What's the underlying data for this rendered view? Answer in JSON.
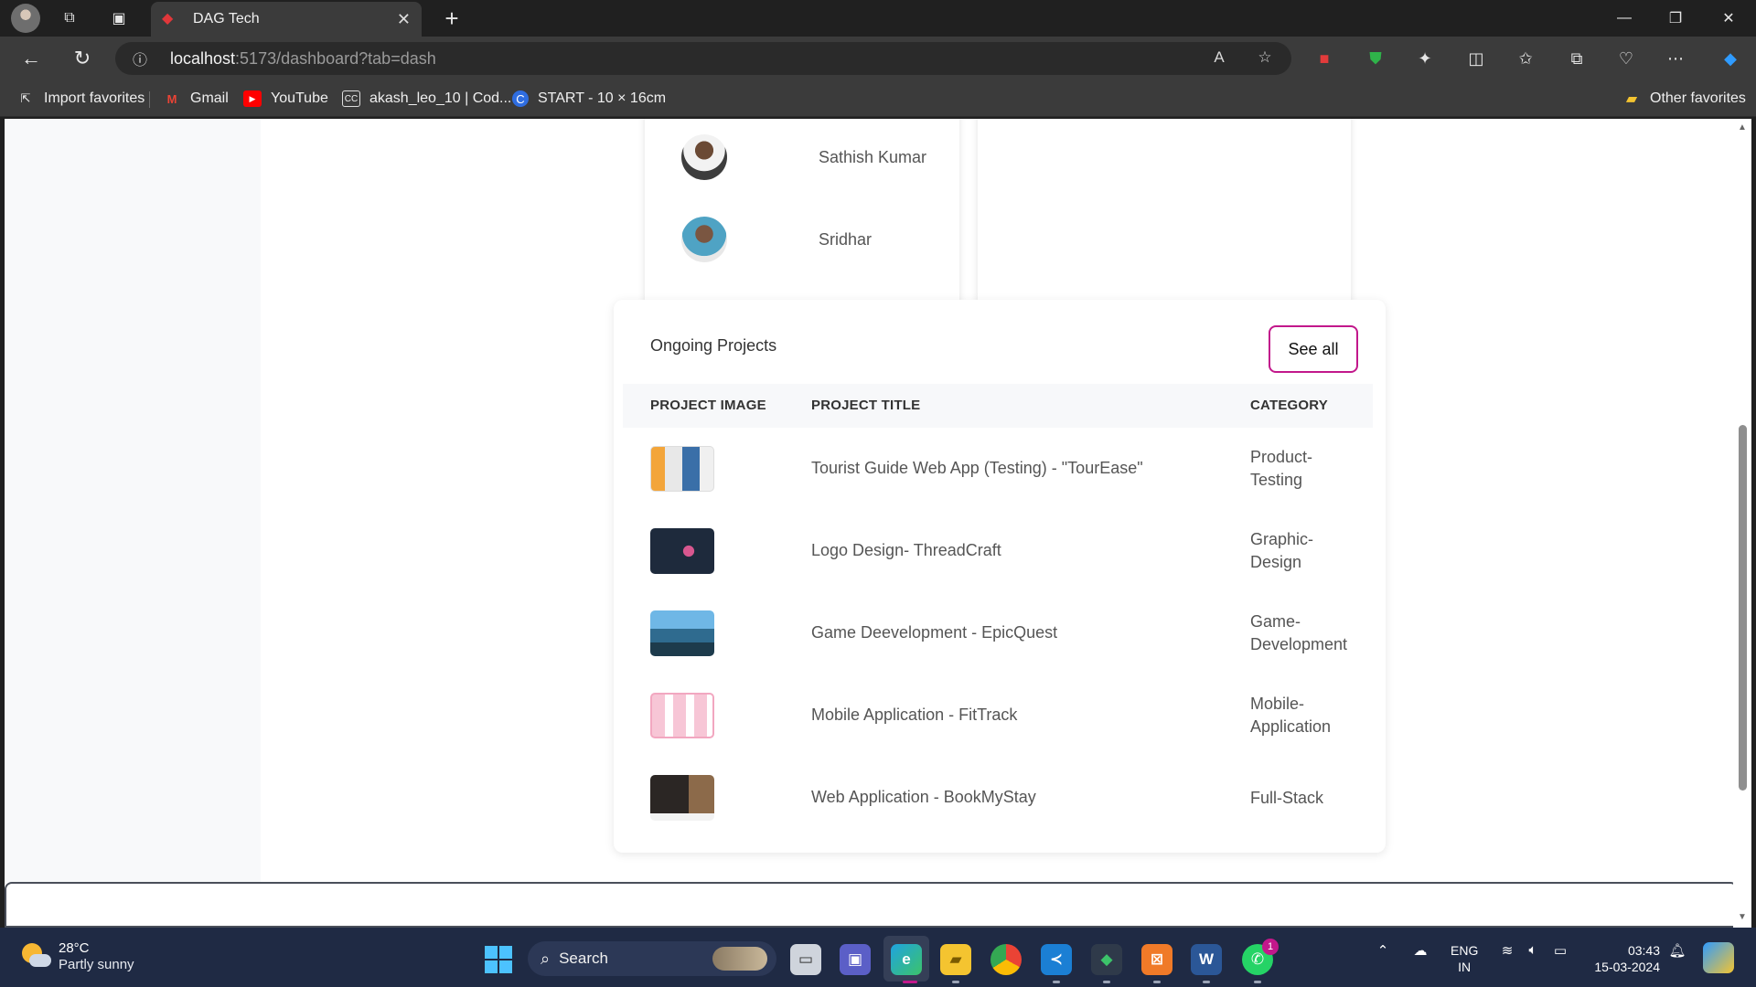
{
  "browser": {
    "tab_title": "DAG Tech",
    "url_host": "localhost",
    "url_rest": ":5173/dashboard?tab=dash",
    "favorites": [
      {
        "label": "Import favorites",
        "icon": "import-icon"
      },
      {
        "label": "Gmail",
        "icon": "gmail-icon"
      },
      {
        "label": "YouTube",
        "icon": "youtube-icon"
      },
      {
        "label": "akash_leo_10 | Cod...",
        "icon": "codechef-icon"
      },
      {
        "label": "START - 10 × 16cm",
        "icon": "canva-icon"
      }
    ],
    "other_favorites": "Other favorites"
  },
  "team": {
    "members": [
      {
        "name": "Sathish Kumar"
      },
      {
        "name": "Sridhar"
      }
    ]
  },
  "projects": {
    "heading": "Ongoing Projects",
    "see_all": "See all",
    "columns": [
      "PROJECT IMAGE",
      "PROJECT TITLE",
      "CATEGORY"
    ],
    "rows": [
      {
        "title": "Tourist Guide Web App (Testing) - \"TourEase\"",
        "category_1": "Product-",
        "category_2": "Testing"
      },
      {
        "title": "Logo Design- ThreadCraft",
        "category_1": "Graphic-",
        "category_2": "Design"
      },
      {
        "title": "Game Deevelopment - EpicQuest",
        "category_1": "Game-",
        "category_2": "Development"
      },
      {
        "title": "Mobile Application - FitTrack",
        "category_1": "Mobile-",
        "category_2": "Application"
      },
      {
        "title": "Web Application - BookMyStay",
        "category_1": "Full-Stack",
        "category_2": ""
      }
    ]
  },
  "taskbar": {
    "temp": "28°C",
    "weather": "Partly sunny",
    "search": "Search",
    "lang_1": "ENG",
    "lang_2": "IN",
    "time": "03:43",
    "date": "15-03-2024",
    "whatsapp_badge": "1"
  },
  "colors": {
    "accent": "#c2188b",
    "sidebar_bg": "#f8f9fa",
    "taskbar_bg": "#1f2a44"
  }
}
